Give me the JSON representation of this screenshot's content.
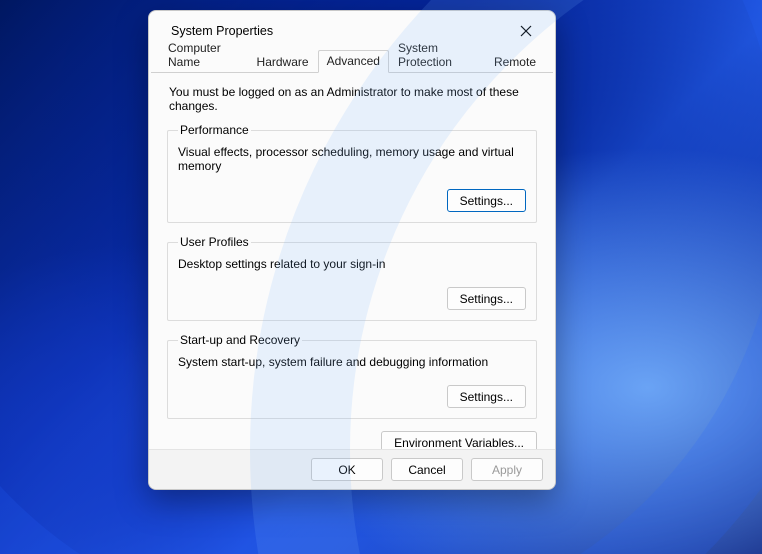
{
  "window": {
    "title": "System Properties"
  },
  "tabs": {
    "computer_name": "Computer Name",
    "hardware": "Hardware",
    "advanced": "Advanced",
    "system_protection": "System Protection",
    "remote": "Remote",
    "active": "advanced"
  },
  "advanced": {
    "info": "You must be logged on as an Administrator to make most of these changes.",
    "performance": {
      "legend": "Performance",
      "desc": "Visual effects, processor scheduling, memory usage and virtual memory",
      "button": "Settings..."
    },
    "user_profiles": {
      "legend": "User Profiles",
      "desc": "Desktop settings related to your sign-in",
      "button": "Settings..."
    },
    "startup": {
      "legend": "Start-up and Recovery",
      "desc": "System start-up, system failure and debugging information",
      "button": "Settings..."
    },
    "env_button": "Environment Variables..."
  },
  "footer": {
    "ok": "OK",
    "cancel": "Cancel",
    "apply": "Apply"
  }
}
